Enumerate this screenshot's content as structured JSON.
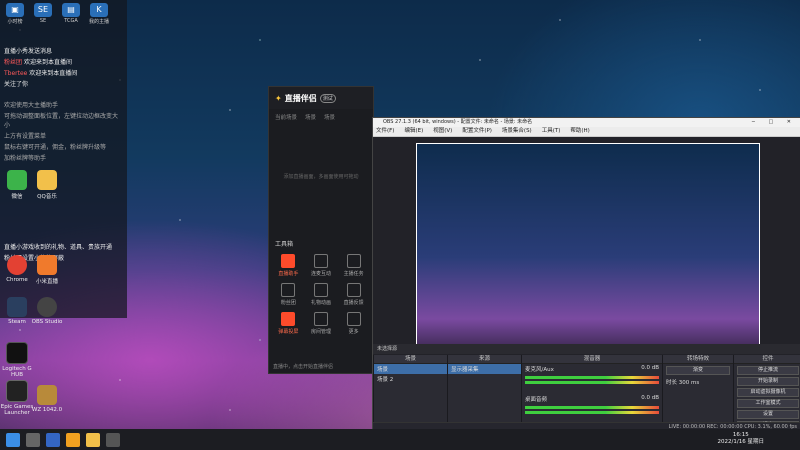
{
  "desktop": {
    "top_icons": [
      {
        "label": "小时榜",
        "glyph": "▣"
      },
      {
        "label": "SE",
        "glyph": "SE"
      },
      {
        "label": "TCGA",
        "glyph": "▤"
      },
      {
        "label": "我的主播",
        "glyph": "K"
      }
    ],
    "chat": [
      {
        "user": "",
        "text": "直播小秀发送消息"
      },
      {
        "user": "粉丝团",
        "text": "欢迎来到本直播间"
      },
      {
        "user": "Tbertee",
        "text": "欢迎来到本直播间"
      },
      {
        "user": "",
        "text": "关注了你"
      }
    ],
    "notice": [
      "欢迎使用大主播助手",
      "可拖动调整面板位置，左键拉动边框改变大小",
      "上方有设置菜单",
      "鼠标右键可开通，佣金，粉丝牌升级等",
      "加粉丝牌等助手"
    ],
    "notice2": [
      "直播小游戏收到的礼物、道具、贵族开通",
      "粉丝可设置小礼物屏蔽"
    ],
    "icons": [
      {
        "label": "微信",
        "color": "#3cb34a"
      },
      {
        "label": "QQ音乐",
        "color": "#f2c04a"
      },
      {
        "label": "Chrome",
        "color": "#e34133"
      },
      {
        "label": "小米直播",
        "color": "#f07a2c"
      },
      {
        "label": "Steam",
        "color": "#2a3f5f"
      },
      {
        "label": "OBS Studio",
        "color": "#444"
      },
      {
        "label": "Logitech G HUB",
        "color": "#111"
      },
      {
        "label": "Epic Games Launcher",
        "color": "#222"
      },
      {
        "label": "WZ 1042.0",
        "color": "#b88a3a"
      }
    ]
  },
  "zhibo": {
    "title": "直播伴侣",
    "badge": "测试",
    "tabs": [
      "当前场景",
      "场景",
      "场景"
    ],
    "placeholder": "添加直播画面，多画面使用可拖动",
    "tools_header": "工具箱",
    "tools": [
      {
        "label": "直播助手",
        "hot": true
      },
      {
        "label": "连麦互动",
        "hot": false
      },
      {
        "label": "主播任务",
        "hot": false
      },
      {
        "label": "粉丝团",
        "hot": false
      },
      {
        "label": "礼物动画",
        "hot": false
      },
      {
        "label": "直播反馈",
        "hot": false
      },
      {
        "label": "弹幕投屏",
        "hot": true
      },
      {
        "label": "房间管理",
        "hot": false
      },
      {
        "label": "更多",
        "hot": false
      }
    ],
    "footer": "直播中，点击开始直播伴侣"
  },
  "obs": {
    "title": "OBS 27.1.3 (64 bit, windows) - 配置文件: 未命名 - 场景: 未命名",
    "menu": [
      "文件(F)",
      "编辑(E)",
      "视图(V)",
      "配置文件(P)",
      "场景集合(S)",
      "工具(T)",
      "帮助(H)"
    ],
    "source_bar": "未选择源",
    "docks": {
      "scenes": {
        "header": "场景",
        "items": [
          "场景",
          "场景 2"
        ]
      },
      "sources": {
        "header": "来源",
        "items": [
          "显示器采集"
        ]
      },
      "mixer": {
        "header": "混音器",
        "channels": [
          {
            "name": "麦克风/Aux",
            "db": "0.0 dB"
          },
          {
            "name": "桌面音频",
            "db": "0.0 dB"
          }
        ]
      },
      "transitions": {
        "header": "转场特效",
        "type": "渐变",
        "duration_label": "时长",
        "duration": "300 ms"
      },
      "controls": {
        "header": "控件",
        "buttons": [
          "停止推流",
          "开始录制",
          "启动虚拟摄像机",
          "工作室模式",
          "设置",
          "退出"
        ]
      }
    },
    "status": "LIVE: 00:00:00  REC: 00:00:00  CPU: 3.1%, 60.00 fps"
  },
  "taskbar": {
    "time": "16:15",
    "date": "2022/1/16 星期日"
  }
}
